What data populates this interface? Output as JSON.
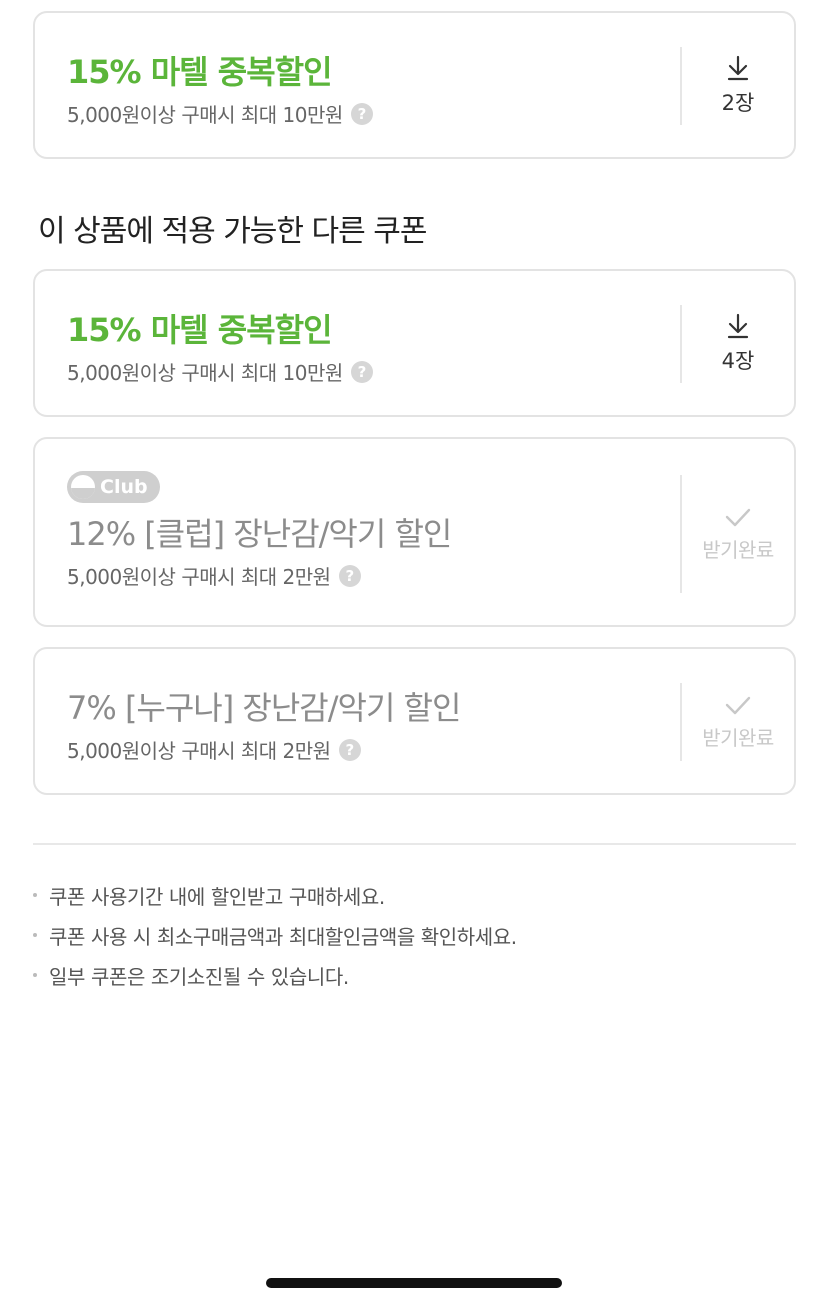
{
  "top_coupon": {
    "title": "15% 마텔 중복할인",
    "condition": "5,000원이상 구매시 최대 10만원",
    "help": "?",
    "count": "2장"
  },
  "section_title": "이 상품에 적용 가능한 다른 쿠폰",
  "coupons": [
    {
      "title": "15% 마텔 중복할인",
      "condition": "5,000원이상 구매시 최대 10만원",
      "help": "?",
      "count": "4장"
    },
    {
      "badge": "Club",
      "title": "12% [클럽] 장난감/악기 할인",
      "condition": "5,000원이상 구매시 최대 2만원",
      "help": "?",
      "status": "받기완료"
    },
    {
      "title": "7% [누구나] 장난감/악기 할인",
      "condition": "5,000원이상 구매시 최대 2만원",
      "help": "?",
      "status": "받기완료"
    }
  ],
  "notes": [
    "쿠폰 사용기간 내에 할인받고 구매하세요.",
    "쿠폰 사용 시 최소구매금액과 최대할인금액을 확인하세요.",
    "일부 쿠폰은 조기소진될 수 있습니다."
  ],
  "colors": {
    "accent_green": "#5bb53a",
    "border": "#e3e3e3",
    "muted": "#8c8c8c"
  },
  "icons": {
    "download": "download-icon",
    "check": "check-icon",
    "help": "help-icon"
  }
}
